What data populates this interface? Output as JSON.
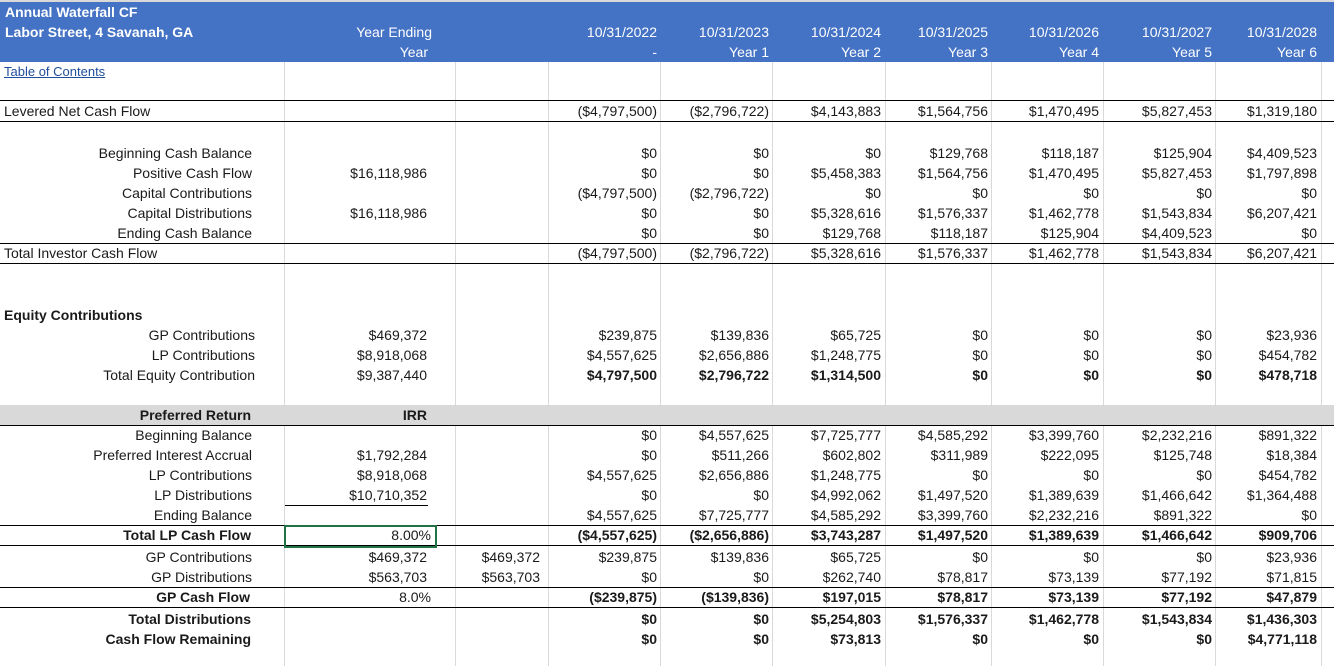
{
  "header": {
    "title_line1": "Annual Waterfall CF",
    "title_line2": "Labor Street, 4 Savanah, GA",
    "col_label_line1": "Year Ending",
    "col_label_line2": "Year",
    "dates": [
      "10/31/2022",
      "10/31/2023",
      "10/31/2024",
      "10/31/2025",
      "10/31/2026",
      "10/31/2027",
      "10/31/2028"
    ],
    "years": [
      "-",
      "Year 1",
      "Year 2",
      "Year 3",
      "Year 4",
      "Year 5",
      "Year 6"
    ]
  },
  "toc_link": "Table of Contents",
  "levered": {
    "label": "Levered Net Cash Flow",
    "values": [
      "($4,797,500)",
      "($2,796,722)",
      "$4,143,883",
      "$1,564,756",
      "$1,470,495",
      "$5,827,453",
      "$1,319,180"
    ]
  },
  "cash_balance": {
    "rows": [
      {
        "label": "Beginning Cash Balance",
        "total": "",
        "values": [
          "$0",
          "$0",
          "$0",
          "$129,768",
          "$118,187",
          "$125,904",
          "$4,409,523"
        ]
      },
      {
        "label": "Positive Cash Flow",
        "total": "$16,118,986",
        "values": [
          "$0",
          "$0",
          "$5,458,383",
          "$1,564,756",
          "$1,470,495",
          "$5,827,453",
          "$1,797,898"
        ]
      },
      {
        "label": "Capital Contributions",
        "total": "",
        "values": [
          "($4,797,500)",
          "($2,796,722)",
          "$0",
          "$0",
          "$0",
          "$0",
          "$0"
        ]
      },
      {
        "label": "Capital Distributions",
        "total": "$16,118,986",
        "values": [
          "$0",
          "$0",
          "$5,328,616",
          "$1,576,337",
          "$1,462,778",
          "$1,543,834",
          "$6,207,421"
        ]
      },
      {
        "label": "Ending Cash Balance",
        "total": "",
        "values": [
          "$0",
          "$0",
          "$129,768",
          "$118,187",
          "$125,904",
          "$4,409,523",
          "$0"
        ]
      }
    ],
    "total_row": {
      "label": "Total Investor Cash Flow",
      "values": [
        "($4,797,500)",
        "($2,796,722)",
        "$5,328,616",
        "$1,576,337",
        "$1,462,778",
        "$1,543,834",
        "$6,207,421"
      ]
    }
  },
  "equity": {
    "heading": "Equity Contributions",
    "rows": [
      {
        "label": "GP Contributions",
        "total": "$469,372",
        "values": [
          "$239,875",
          "$139,836",
          "$65,725",
          "$0",
          "$0",
          "$0",
          "$23,936"
        ]
      },
      {
        "label": "LP Contributions",
        "total": "$8,918,068",
        "values": [
          "$4,557,625",
          "$2,656,886",
          "$1,248,775",
          "$0",
          "$0",
          "$0",
          "$454,782"
        ]
      },
      {
        "label": "Total Equity Contribution",
        "total": "$9,387,440",
        "values": [
          "$4,797,500",
          "$2,796,722",
          "$1,314,500",
          "$0",
          "$0",
          "$0",
          "$478,718"
        ]
      }
    ]
  },
  "preferred": {
    "heading": "Preferred Return",
    "irr_label": "IRR",
    "rows": [
      {
        "label": "Beginning Balance",
        "total": "",
        "values": [
          "$0",
          "$4,557,625",
          "$7,725,777",
          "$4,585,292",
          "$3,399,760",
          "$2,232,216",
          "$891,322"
        ]
      },
      {
        "label": "Preferred Interest Accrual",
        "total": "$1,792,284",
        "values": [
          "$0",
          "$511,266",
          "$602,802",
          "$311,989",
          "$222,095",
          "$125,748",
          "$18,384"
        ]
      },
      {
        "label": "LP Contributions",
        "total": "$8,918,068",
        "values": [
          "$4,557,625",
          "$2,656,886",
          "$1,248,775",
          "$0",
          "$0",
          "$0",
          "$454,782"
        ]
      },
      {
        "label": "LP Distributions",
        "total": "$10,710,352",
        "values": [
          "$0",
          "$0",
          "$4,992,062",
          "$1,497,520",
          "$1,389,639",
          "$1,466,642",
          "$1,364,488"
        ]
      },
      {
        "label": "Ending Balance",
        "total": "",
        "values": [
          "$4,557,625",
          "$7,725,777",
          "$4,585,292",
          "$3,399,760",
          "$2,232,216",
          "$891,322",
          "$0"
        ]
      }
    ],
    "lp_total": {
      "label": "Total LP Cash Flow",
      "irr": "8.00%",
      "values": [
        "($4,557,625)",
        "($2,656,886)",
        "$3,743,287",
        "$1,497,520",
        "$1,389,639",
        "$1,466,642",
        "$909,706"
      ]
    },
    "gp_contrib": {
      "label": "GP Contributions",
      "total": "$469,372",
      "extra": "$469,372",
      "values": [
        "$239,875",
        "$139,836",
        "$65,725",
        "$0",
        "$0",
        "$0",
        "$23,936"
      ]
    },
    "gp_dist": {
      "label": "GP Distributions",
      "total": "$563,703",
      "extra": "$563,703",
      "values": [
        "$0",
        "$0",
        "$262,740",
        "$78,817",
        "$73,139",
        "$77,192",
        "$71,815"
      ]
    },
    "gp_total": {
      "label": "GP Cash Flow",
      "irr": "8.0%",
      "values": [
        "($239,875)",
        "($139,836)",
        "$197,015",
        "$78,817",
        "$73,139",
        "$77,192",
        "$47,879"
      ]
    },
    "total_dist": {
      "label": "Total Distributions",
      "values": [
        "$0",
        "$0",
        "$5,254,803",
        "$1,576,337",
        "$1,462,778",
        "$1,543,834",
        "$1,436,303"
      ]
    },
    "remaining": {
      "label": "Cash Flow Remaining",
      "values": [
        "$0",
        "$0",
        "$73,813",
        "$0",
        "$0",
        "$0",
        "$4,771,118"
      ]
    }
  },
  "colors": {
    "header_bg": "#4472c4",
    "band_gray": "#d9d9d9",
    "selection": "#217346"
  }
}
